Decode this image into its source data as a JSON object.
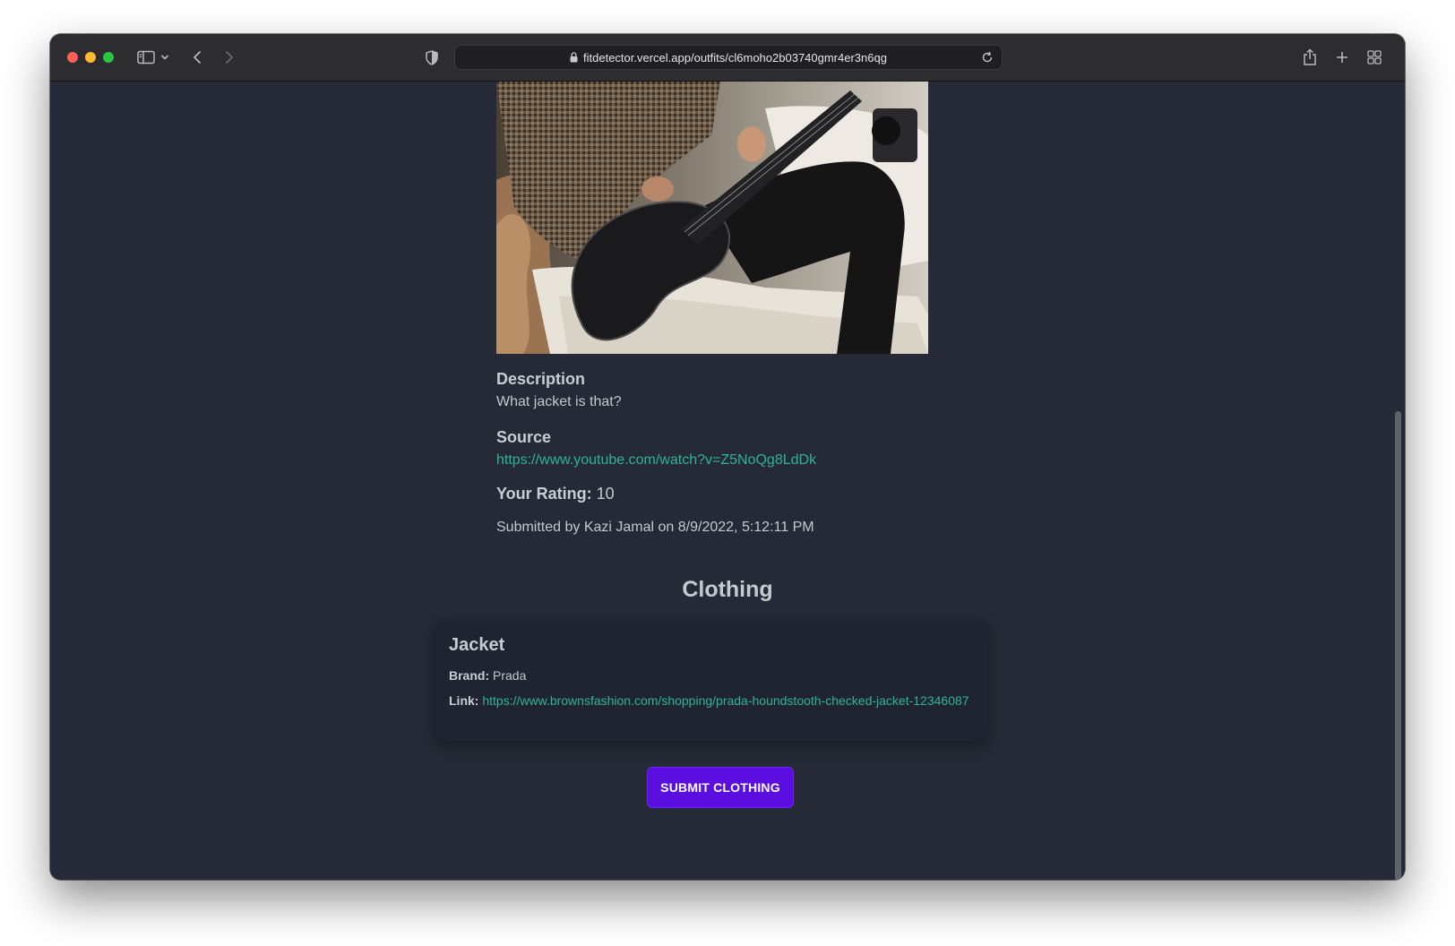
{
  "browser": {
    "url": "fitdetector.vercel.app/outfits/cl6moho2b03740gmr4er3n6qg",
    "icons": [
      "sidebar-icon",
      "chevron-down-icon",
      "back-icon",
      "forward-icon",
      "shield-icon",
      "lock-icon",
      "reload-icon",
      "share-icon",
      "new-tab-icon",
      "tab-overview-icon"
    ]
  },
  "outfit": {
    "image_alt": "person in houndstooth jacket playing guitar",
    "description_heading": "Description",
    "description": "What jacket is that?",
    "source_heading": "Source",
    "source_url": "https://www.youtube.com/watch?v=Z5NoQg8LdDk",
    "rating_label": "Your Rating:",
    "rating_value": "10",
    "submitted": "Submitted by Kazi Jamal on 8/9/2022, 5:12:11 PM"
  },
  "clothing": {
    "section_title": "Clothing",
    "items": [
      {
        "name": "Jacket",
        "brand_label": "Brand:",
        "brand": "Prada",
        "link_label": "Link:",
        "link": "https://www.brownsfashion.com/shopping/prada-houndstooth-checked-jacket-12346087"
      }
    ],
    "submit_label": "SUBMIT CLOTHING"
  },
  "colors": {
    "page_bg": "#252a36",
    "card_bg": "#202430",
    "link": "#2fb39a",
    "button": "#5a0fe0"
  }
}
